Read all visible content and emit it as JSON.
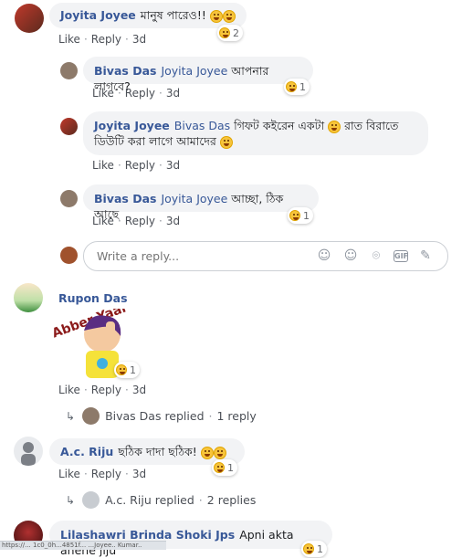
{
  "actions": {
    "like": "Like",
    "reply": "Reply",
    "sep": "·"
  },
  "comments": [
    {
      "author": "Joyita Joyee",
      "mention": "",
      "text": "মানুষ পারেও!!",
      "time": "3d",
      "reactions": "2"
    },
    {
      "author": "Bivas Das",
      "mention": "Joyita Joyee",
      "text": "আপনার লাগবে?",
      "time": "3d",
      "reactions": "1"
    },
    {
      "author": "Joyita Joyee",
      "mention": "Bivas Das",
      "text": "গিফট কইরেন একটা",
      "text2": "রাত বিরাতে",
      "line2": "ডিউটি করা লাগে আমাদের",
      "time": "3d"
    },
    {
      "author": "Bivas Das",
      "mention": "Joyita Joyee",
      "text": "আচ্ছা, ঠিক আছে",
      "time": "3d",
      "reactions": "1"
    },
    {
      "author": "Rupon Das",
      "sticker": "Abber Yaar",
      "time": "3d",
      "reactions": "1"
    },
    {
      "author": "A.c. Riju",
      "text": "ছঠিক দাদা ছঠিক!",
      "time": "3d",
      "reactions": "1"
    },
    {
      "author": "Lilashawri Brinda Shoki Jps",
      "text": "Apni akta anene jiju",
      "reactions": "1"
    }
  ],
  "reply_box": {
    "placeholder": "Write a reply..."
  },
  "threads": [
    {
      "name": "Bivas Das",
      "action": "replied",
      "count": "1 reply"
    },
    {
      "name": "A.c. Riju",
      "action": "replied",
      "count": "2 replies"
    }
  ],
  "status_text": "https://... 1c0_0h...4851f... ...Joyee.. Kumar.."
}
